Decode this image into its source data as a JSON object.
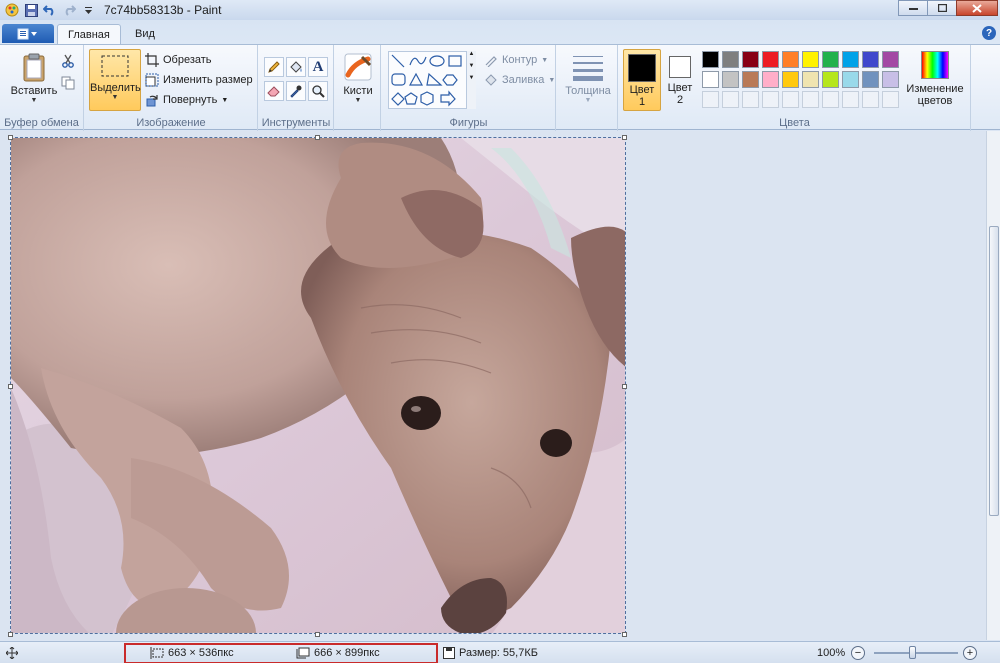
{
  "window": {
    "title": "7c74bb58313b - Paint"
  },
  "tabs": {
    "home": "Главная",
    "view": "Вид"
  },
  "clipboard": {
    "paste_label": "Вставить",
    "group_label": "Буфер обмена"
  },
  "image": {
    "select_label": "Выделить",
    "crop_label": "Обрезать",
    "resize_label": "Изменить размер",
    "rotate_label": "Повернуть",
    "group_label": "Изображение"
  },
  "tools": {
    "group_label": "Инструменты",
    "items": [
      "pencil-icon",
      "fill-icon",
      "text-icon",
      "eraser-icon",
      "color-picker-icon",
      "magnifier-icon"
    ]
  },
  "brushes": {
    "label": "Кисти"
  },
  "shapes": {
    "group_label": "Фигуры",
    "outline_label": "Контур",
    "fill_label": "Заливка"
  },
  "thickness": {
    "label": "Толщина"
  },
  "colors": {
    "group_label": "Цвета",
    "color1_label": "Цвет",
    "color1_num": "1",
    "color2_label": "Цвет",
    "color2_num": "2",
    "edit_label_1": "Изменение",
    "edit_label_2": "цветов",
    "color1": "#000000",
    "color2": "#ffffff",
    "palette_row1": [
      "#000000",
      "#7f7f7f",
      "#880015",
      "#ed1c24",
      "#ff7f27",
      "#fff200",
      "#22b14c",
      "#00a2e8",
      "#3f48cc",
      "#a349a4"
    ],
    "palette_row2": [
      "#ffffff",
      "#c3c3c3",
      "#b97a57",
      "#ffaec9",
      "#ffc90e",
      "#efe4b0",
      "#b5e61d",
      "#99d9ea",
      "#7092be",
      "#c8bfe7"
    ]
  },
  "status": {
    "selection_size": "663 × 536пкс",
    "image_size": "666 × 899пкс",
    "file_size": "Размер: 55,7КБ",
    "zoom": "100%"
  }
}
